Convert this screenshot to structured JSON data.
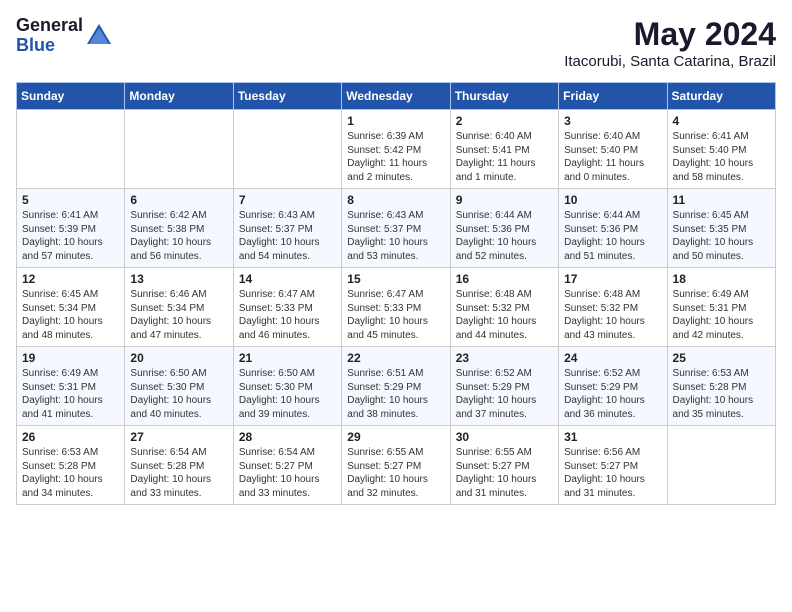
{
  "logo": {
    "general": "General",
    "blue": "Blue"
  },
  "header": {
    "month_year": "May 2024",
    "location": "Itacorubi, Santa Catarina, Brazil"
  },
  "weekdays": [
    "Sunday",
    "Monday",
    "Tuesday",
    "Wednesday",
    "Thursday",
    "Friday",
    "Saturday"
  ],
  "weeks": [
    [
      {
        "day": "",
        "info": ""
      },
      {
        "day": "",
        "info": ""
      },
      {
        "day": "",
        "info": ""
      },
      {
        "day": "1",
        "info": "Sunrise: 6:39 AM\nSunset: 5:42 PM\nDaylight: 11 hours\nand 2 minutes."
      },
      {
        "day": "2",
        "info": "Sunrise: 6:40 AM\nSunset: 5:41 PM\nDaylight: 11 hours\nand 1 minute."
      },
      {
        "day": "3",
        "info": "Sunrise: 6:40 AM\nSunset: 5:40 PM\nDaylight: 11 hours\nand 0 minutes."
      },
      {
        "day": "4",
        "info": "Sunrise: 6:41 AM\nSunset: 5:40 PM\nDaylight: 10 hours\nand 58 minutes."
      }
    ],
    [
      {
        "day": "5",
        "info": "Sunrise: 6:41 AM\nSunset: 5:39 PM\nDaylight: 10 hours\nand 57 minutes."
      },
      {
        "day": "6",
        "info": "Sunrise: 6:42 AM\nSunset: 5:38 PM\nDaylight: 10 hours\nand 56 minutes."
      },
      {
        "day": "7",
        "info": "Sunrise: 6:43 AM\nSunset: 5:37 PM\nDaylight: 10 hours\nand 54 minutes."
      },
      {
        "day": "8",
        "info": "Sunrise: 6:43 AM\nSunset: 5:37 PM\nDaylight: 10 hours\nand 53 minutes."
      },
      {
        "day": "9",
        "info": "Sunrise: 6:44 AM\nSunset: 5:36 PM\nDaylight: 10 hours\nand 52 minutes."
      },
      {
        "day": "10",
        "info": "Sunrise: 6:44 AM\nSunset: 5:36 PM\nDaylight: 10 hours\nand 51 minutes."
      },
      {
        "day": "11",
        "info": "Sunrise: 6:45 AM\nSunset: 5:35 PM\nDaylight: 10 hours\nand 50 minutes."
      }
    ],
    [
      {
        "day": "12",
        "info": "Sunrise: 6:45 AM\nSunset: 5:34 PM\nDaylight: 10 hours\nand 48 minutes."
      },
      {
        "day": "13",
        "info": "Sunrise: 6:46 AM\nSunset: 5:34 PM\nDaylight: 10 hours\nand 47 minutes."
      },
      {
        "day": "14",
        "info": "Sunrise: 6:47 AM\nSunset: 5:33 PM\nDaylight: 10 hours\nand 46 minutes."
      },
      {
        "day": "15",
        "info": "Sunrise: 6:47 AM\nSunset: 5:33 PM\nDaylight: 10 hours\nand 45 minutes."
      },
      {
        "day": "16",
        "info": "Sunrise: 6:48 AM\nSunset: 5:32 PM\nDaylight: 10 hours\nand 44 minutes."
      },
      {
        "day": "17",
        "info": "Sunrise: 6:48 AM\nSunset: 5:32 PM\nDaylight: 10 hours\nand 43 minutes."
      },
      {
        "day": "18",
        "info": "Sunrise: 6:49 AM\nSunset: 5:31 PM\nDaylight: 10 hours\nand 42 minutes."
      }
    ],
    [
      {
        "day": "19",
        "info": "Sunrise: 6:49 AM\nSunset: 5:31 PM\nDaylight: 10 hours\nand 41 minutes."
      },
      {
        "day": "20",
        "info": "Sunrise: 6:50 AM\nSunset: 5:30 PM\nDaylight: 10 hours\nand 40 minutes."
      },
      {
        "day": "21",
        "info": "Sunrise: 6:50 AM\nSunset: 5:30 PM\nDaylight: 10 hours\nand 39 minutes."
      },
      {
        "day": "22",
        "info": "Sunrise: 6:51 AM\nSunset: 5:29 PM\nDaylight: 10 hours\nand 38 minutes."
      },
      {
        "day": "23",
        "info": "Sunrise: 6:52 AM\nSunset: 5:29 PM\nDaylight: 10 hours\nand 37 minutes."
      },
      {
        "day": "24",
        "info": "Sunrise: 6:52 AM\nSunset: 5:29 PM\nDaylight: 10 hours\nand 36 minutes."
      },
      {
        "day": "25",
        "info": "Sunrise: 6:53 AM\nSunset: 5:28 PM\nDaylight: 10 hours\nand 35 minutes."
      }
    ],
    [
      {
        "day": "26",
        "info": "Sunrise: 6:53 AM\nSunset: 5:28 PM\nDaylight: 10 hours\nand 34 minutes."
      },
      {
        "day": "27",
        "info": "Sunrise: 6:54 AM\nSunset: 5:28 PM\nDaylight: 10 hours\nand 33 minutes."
      },
      {
        "day": "28",
        "info": "Sunrise: 6:54 AM\nSunset: 5:27 PM\nDaylight: 10 hours\nand 33 minutes."
      },
      {
        "day": "29",
        "info": "Sunrise: 6:55 AM\nSunset: 5:27 PM\nDaylight: 10 hours\nand 32 minutes."
      },
      {
        "day": "30",
        "info": "Sunrise: 6:55 AM\nSunset: 5:27 PM\nDaylight: 10 hours\nand 31 minutes."
      },
      {
        "day": "31",
        "info": "Sunrise: 6:56 AM\nSunset: 5:27 PM\nDaylight: 10 hours\nand 31 minutes."
      },
      {
        "day": "",
        "info": ""
      }
    ]
  ]
}
